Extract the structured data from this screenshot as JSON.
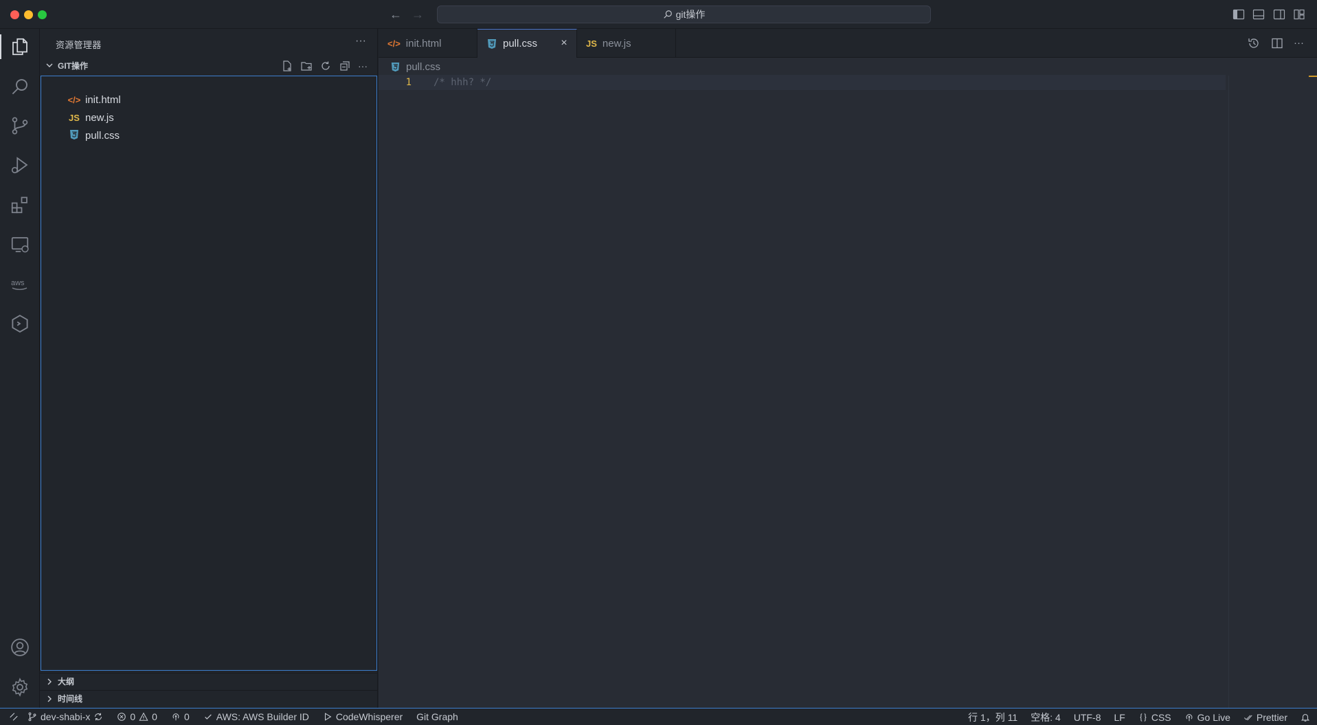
{
  "window": {
    "search_text": "git操作"
  },
  "sidebar": {
    "title": "资源管理器",
    "more": "···",
    "section_title": "GIT操作",
    "files": [
      {
        "name": "init.html",
        "icon": "</>"
      },
      {
        "name": "new.js",
        "icon": "JS"
      },
      {
        "name": "pull.css",
        "icon": "css-icon"
      }
    ],
    "outline_label": "大纲",
    "timeline_label": "时间线"
  },
  "tabs": [
    {
      "label": "init.html",
      "icon": "</>"
    },
    {
      "label": "pull.css",
      "icon": "css-icon"
    },
    {
      "label": "new.js",
      "icon": "JS"
    }
  ],
  "editor": {
    "breadcrumb": "pull.css",
    "line_number": "1",
    "code_line": "/* hhh? */"
  },
  "statusbar": {
    "branch": "dev-shabi-x",
    "errors": "0",
    "warnings": "0",
    "ports": "0",
    "aws": "AWS: AWS Builder ID",
    "codewhisperer": "CodeWhisperer",
    "git_graph": "Git Graph",
    "position": "行 1，列 11",
    "spaces": "空格: 4",
    "encoding": "UTF-8",
    "eol": "LF",
    "language": "CSS",
    "go_live": "Go Live",
    "prettier": "Prettier"
  },
  "colors": {
    "accent": "#3d7fce",
    "html_icon": "#e37933",
    "js_icon": "#e0b84a",
    "css_icon": "#519aba",
    "line_number": "#e0b84a"
  }
}
